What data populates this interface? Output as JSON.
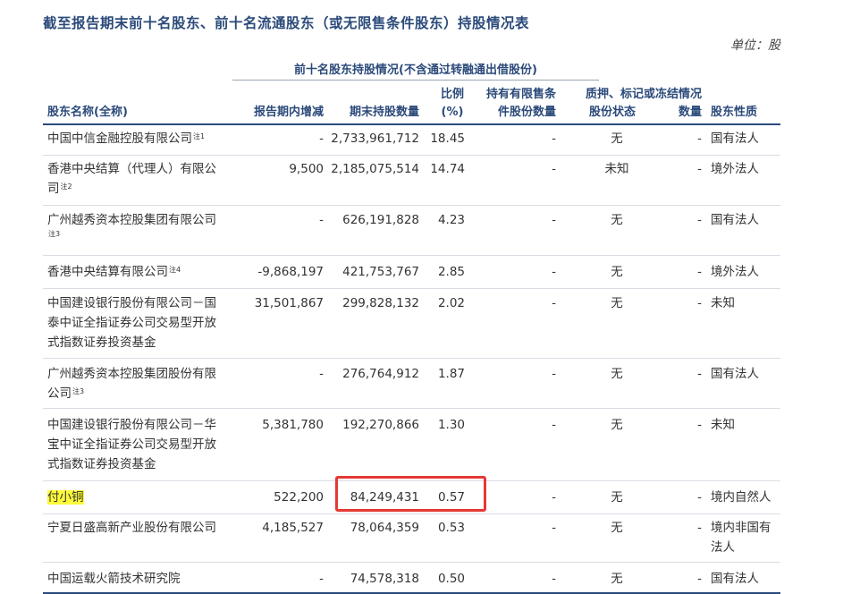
{
  "title": "截至报告期末前十名股东、前十名流通股东（或无限售条件股东）持股情况表",
  "unit": "单位：股",
  "subtitle": "前十名股东持股情况(不含通过转融通出借股份)",
  "headers": {
    "name": "股东名称(全称)",
    "change": "报告期内增减",
    "shares": "期末持股数量",
    "ratio_1": "比例",
    "ratio_2": "(%)",
    "restricted_1": "持有有限售条",
    "restricted_2": "件股份数量",
    "pledge_group": "质押、标记或冻结情况",
    "pledge_status": "股份状态",
    "pledge_qty": "数量",
    "nature": "股东性质"
  },
  "rows": [
    {
      "name": "中国中信金融控股有限公司",
      "note": "注1",
      "change": "-",
      "shares": "2,733,961,712",
      "ratio": "18.45",
      "restricted": "-",
      "status": "无",
      "qty": "-",
      "nature": "国有法人"
    },
    {
      "name_1": "香港中央结算（代理人）有限公",
      "name_2": "司",
      "note": "注2",
      "change": "9,500",
      "shares": "2,185,075,514",
      "ratio": "14.74",
      "restricted": "-",
      "status": "未知",
      "qty": "-",
      "nature": "境外法人"
    },
    {
      "name_1": "广州越秀资本控股集团有限公司",
      "note": "注3",
      "change": "-",
      "shares": "626,191,828",
      "ratio": "4.23",
      "restricted": "-",
      "status": "无",
      "qty": "-",
      "nature": "国有法人"
    },
    {
      "name": "香港中央结算有限公司",
      "note": "注4",
      "change": "-9,868,197",
      "shares": "421,753,767",
      "ratio": "2.85",
      "restricted": "-",
      "status": "无",
      "qty": "-",
      "nature": "境外法人"
    },
    {
      "name_1": "中国建设银行股份有限公司－国",
      "name_2": "泰中证全指证券公司交易型开放",
      "name_3": "式指数证券投资基金",
      "change": "31,501,867",
      "shares": "299,828,132",
      "ratio": "2.02",
      "restricted": "-",
      "status": "无",
      "qty": "-",
      "nature": "未知"
    },
    {
      "name_1": "广州越秀资本控股集团股份有限",
      "name_2": "公司",
      "note": "注3",
      "change": "-",
      "shares": "276,764,912",
      "ratio": "1.87",
      "restricted": "-",
      "status": "无",
      "qty": "-",
      "nature": "国有法人"
    },
    {
      "name_1": "中国建设银行股份有限公司－华",
      "name_2": "宝中证全指证券公司交易型开放",
      "name_3": "式指数证券投资基金",
      "change": "5,381,780",
      "shares": "192,270,866",
      "ratio": "1.30",
      "restricted": "-",
      "status": "无",
      "qty": "-",
      "nature": "未知"
    },
    {
      "name": "付小铜",
      "change": "522,200",
      "shares": "84,249,431",
      "ratio": "0.57",
      "restricted": "-",
      "status": "无",
      "qty": "-",
      "nature": "境内自然人"
    },
    {
      "name": "宁夏日盛高新产业股份有限公司",
      "change": "4,185,527",
      "shares": "78,064,359",
      "ratio": "0.53",
      "restricted": "-",
      "status": "无",
      "qty": "-",
      "nature_1": "境内非国有",
      "nature_2": "法人"
    },
    {
      "name": "中国运载火箭技术研究院",
      "change": "-",
      "shares": "74,578,318",
      "ratio": "0.50",
      "restricted": "-",
      "status": "无",
      "qty": "-",
      "nature": "国有法人"
    }
  ],
  "colors": {
    "heading": "#2b4a7a",
    "highlight": "#fffb3a",
    "annotation": "#e53935"
  }
}
